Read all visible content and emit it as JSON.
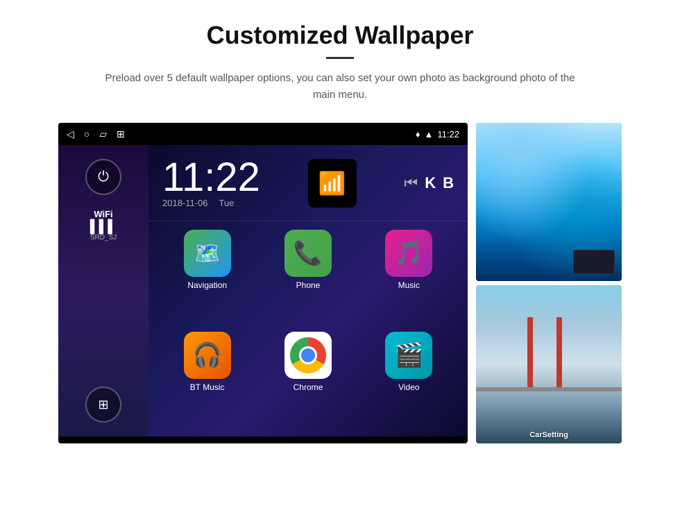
{
  "header": {
    "title": "Customized Wallpaper",
    "description": "Preload over 5 default wallpaper options, you can also set your own photo as background photo of the main menu."
  },
  "android": {
    "status_bar": {
      "time": "11:22",
      "icons_left": [
        "back-arrow",
        "home-circle",
        "square-recents",
        "image-icon"
      ],
      "icons_right": [
        "location-pin",
        "wifi",
        "time"
      ]
    },
    "clock": {
      "time": "11:22",
      "date": "2018-11-06",
      "day": "Tue"
    },
    "wifi": {
      "label": "WiFi",
      "ssid": "SRD_SJ"
    },
    "apps": [
      {
        "name": "Navigation",
        "icon": "nav"
      },
      {
        "name": "Phone",
        "icon": "phone"
      },
      {
        "name": "Music",
        "icon": "music"
      },
      {
        "name": "BT Music",
        "icon": "bt"
      },
      {
        "name": "Chrome",
        "icon": "chrome"
      },
      {
        "name": "Video",
        "icon": "video"
      }
    ]
  },
  "wallpapers": [
    {
      "name": "ice-cave",
      "label": ""
    },
    {
      "name": "golden-gate",
      "label": "CarSetting"
    }
  ]
}
